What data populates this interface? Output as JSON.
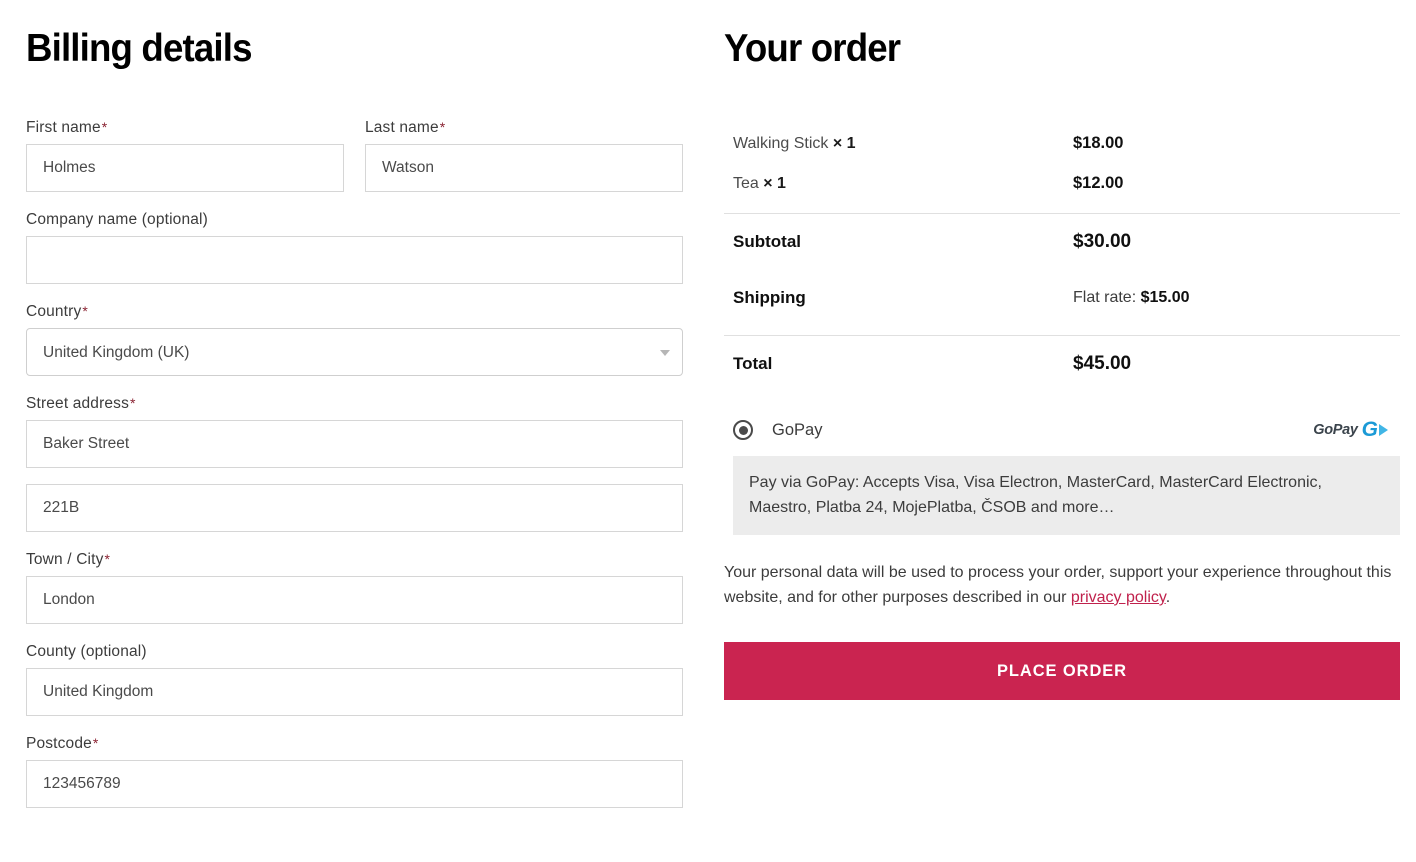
{
  "billing": {
    "title": "Billing details",
    "fields": [
      {
        "label": "First name",
        "required": true,
        "value": "Holmes",
        "placeholder": ""
      },
      {
        "label": "Last name",
        "required": true,
        "value": "Watson",
        "placeholder": ""
      },
      {
        "label": "Company name (optional)",
        "required": false,
        "value": "",
        "placeholder": ""
      },
      {
        "label": "Country",
        "required": true,
        "value": "United Kingdom (UK)",
        "placeholder": ""
      },
      {
        "label": "Street address",
        "required": true,
        "value": "Baker Street",
        "placeholder": ""
      },
      {
        "label": "",
        "required": false,
        "value": "221B",
        "placeholder": ""
      },
      {
        "label": "Town / City",
        "required": true,
        "value": "London",
        "placeholder": ""
      },
      {
        "label": "County (optional)",
        "required": false,
        "value": "United Kingdom",
        "placeholder": ""
      },
      {
        "label": "Postcode",
        "required": true,
        "value": "123456789",
        "placeholder": ""
      }
    ],
    "required_mark": "*"
  },
  "order": {
    "title": "Your order",
    "items": [
      {
        "name": "Walking Stick",
        "qty": "× 1",
        "price": "$18.00"
      },
      {
        "name": "Tea",
        "qty": "× 1",
        "price": "$12.00"
      }
    ],
    "subtotal_label": "Subtotal",
    "subtotal_value": "$30.00",
    "shipping_label": "Shipping",
    "shipping_prefix": "Flat rate: ",
    "shipping_value": "$15.00",
    "total_label": "Total",
    "total_value": "$45.00"
  },
  "payment": {
    "method_label": "GoPay",
    "logo_word": "GoPay",
    "logo_letter": "G",
    "selected": true,
    "description": "Pay via GoPay: Accepts Visa, Visa Electron, MasterCard, MasterCard Electronic, Maestro, Platba 24, MojePlatba, ČSOB and more…"
  },
  "privacy": {
    "text_before": "Your personal data will be used to process your order, support your experience throughout this website, and for other purposes described in our ",
    "link_text": "privacy policy",
    "text_after": "."
  },
  "actions": {
    "place_order_label": "PLACE ORDER"
  },
  "colors": {
    "accent": "#ca2450",
    "link": "#c0214c",
    "required": "#8a2332",
    "gopay_blue": "#1b9ad6",
    "desc_bg": "#ececec",
    "border": "#d6d6d6"
  }
}
